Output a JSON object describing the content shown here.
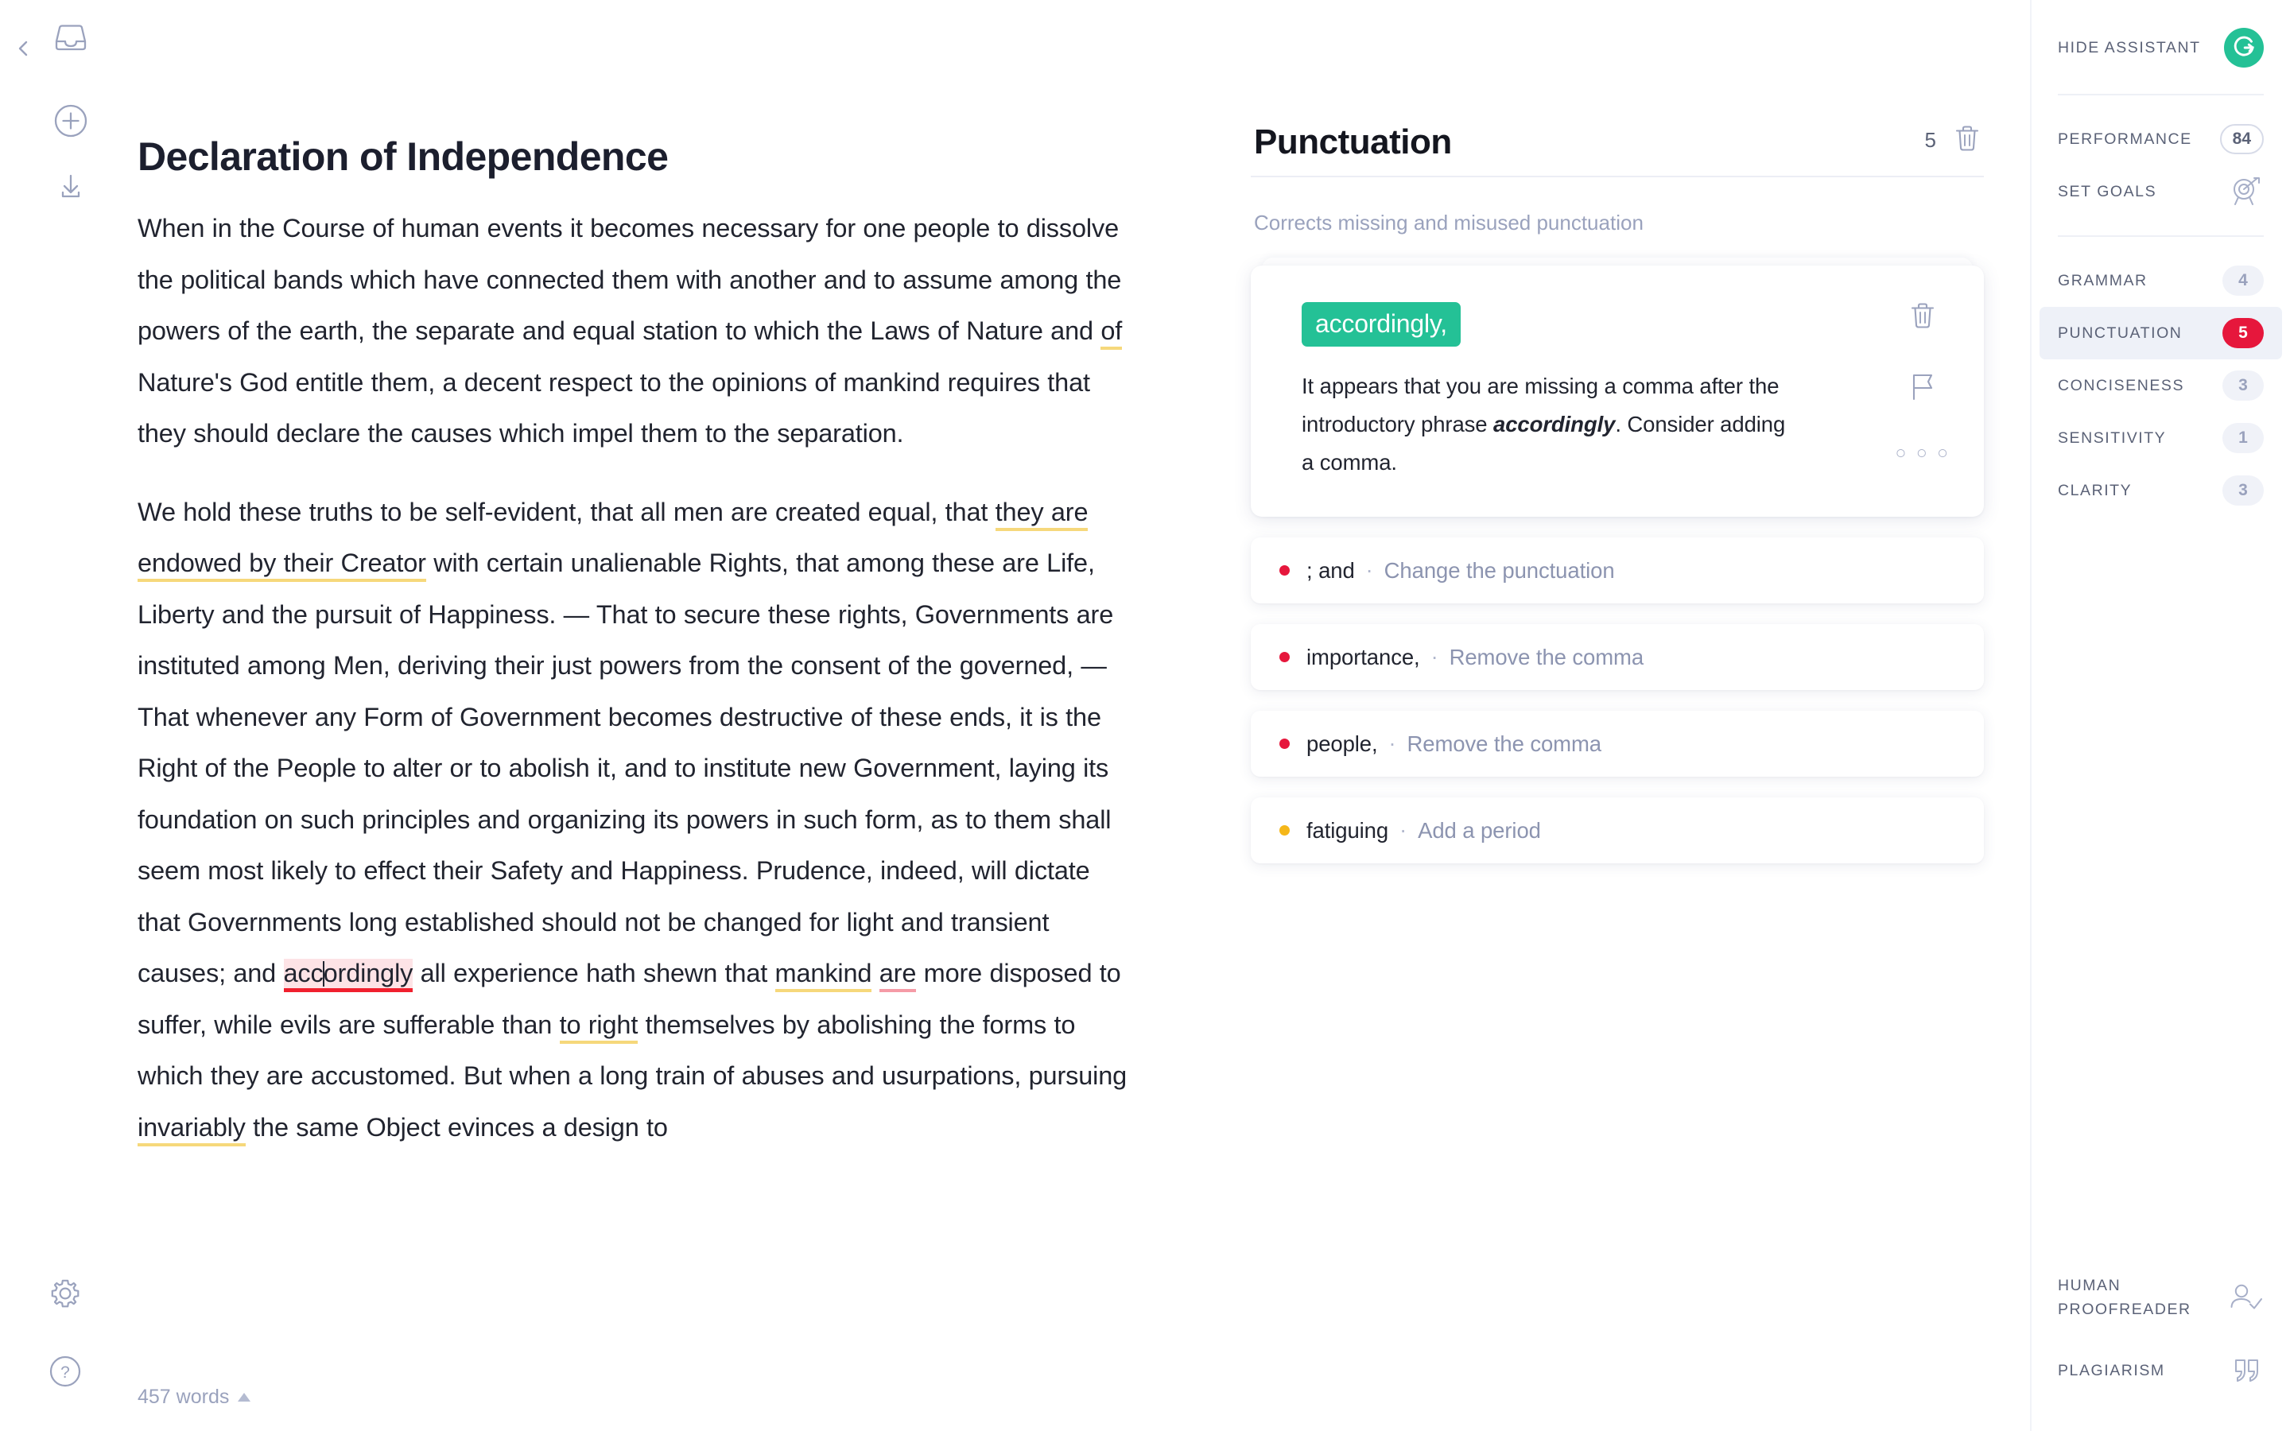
{
  "left_rail": {
    "back_icon": "chevron-left-icon",
    "inbox_icon": "inbox-icon",
    "new_icon": "plus-circle-icon",
    "download_icon": "download-icon",
    "settings_icon": "gear-icon",
    "help_icon": "question-circle-icon"
  },
  "document": {
    "title": "Declaration of Independence",
    "word_count": "457 words",
    "paragraphs": [
      {
        "runs": [
          {
            "text": "When in the Course of human events it becomes necessary for one people to dissolve the political bands which have connected them with another and to assume among the powers of the earth, the separate and equal station to which the Laws of Nature and ",
            "style": "plain"
          },
          {
            "text": "of",
            "style": "yellow"
          },
          {
            "text": " Nature's God entitle them, a decent respect to the opinions of mankind requires that they should declare the causes which impel them to the separation.",
            "style": "plain"
          }
        ]
      },
      {
        "runs": [
          {
            "text": "We hold these truths to be self-evident, that all men are created equal, that ",
            "style": "plain"
          },
          {
            "text": "they are endowed by their Creator",
            "style": "yellow"
          },
          {
            "text": " with certain unalienable Rights, that among these are Life, Liberty and the pursuit of Happiness. — That to secure these rights, Governments are instituted among Men, deriving their just powers from the consent of the governed, — That whenever any Form of Government becomes destructive of these ends, it is the Right of the People to alter or to abolish it, and to institute new Government, laying its foundation on such principles and organizing its powers in such form, as to them shall seem most likely to effect their Safety and Happiness. Prudence, indeed, will dictate that Governments long established should not be changed for light and transient causes; and ",
            "style": "plain"
          },
          {
            "text": "accordingly",
            "style": "active",
            "caret_after": 3
          },
          {
            "text": " all experience hath shewn that ",
            "style": "plain"
          },
          {
            "text": "mankind",
            "style": "yellow"
          },
          {
            "text": " ",
            "style": "plain"
          },
          {
            "text": "are",
            "style": "pink"
          },
          {
            "text": " more disposed to suffer, while evils are sufferable than ",
            "style": "plain"
          },
          {
            "text": "to right",
            "style": "yellow"
          },
          {
            "text": " themselves by abolishing the forms to which they are accustomed. But when a long train of abuses and usurpations, pursuing ",
            "style": "plain"
          },
          {
            "text": "invariably",
            "style": "yellow"
          },
          {
            "text": " the same Object evinces a design to",
            "style": "plain"
          }
        ]
      }
    ]
  },
  "assistant": {
    "title": "Punctuation",
    "count": "5",
    "delete_icon": "trash-icon",
    "subtitle": "Corrects missing and misused punctuation",
    "card": {
      "chip": "accordingly,",
      "explanation_before": "It appears that you are missing a comma after the introductory phrase ",
      "explanation_emphasis": "accordingly",
      "explanation_after": ". Consider adding a comma.",
      "delete_icon": "trash-icon",
      "flag_icon": "flag-icon",
      "more_icon": "more-options-icon",
      "more_glyph": "○ ○ ○"
    },
    "suggestions": [
      {
        "word": "; and",
        "separator": "·",
        "action": "Change the punctuation",
        "dot_color": "#e6173c"
      },
      {
        "word": "importance,",
        "separator": "·",
        "action": "Remove the comma",
        "dot_color": "#e6173c"
      },
      {
        "word": "people,",
        "separator": "·",
        "action": "Remove the comma",
        "dot_color": "#e6173c"
      },
      {
        "word": "fatiguing",
        "separator": "·",
        "action": "Add a period",
        "dot_color": "#f5b719"
      }
    ]
  },
  "sidebar": {
    "hide_label": "HIDE ASSISTANT",
    "logo_name": "grammarly-logo",
    "group1": [
      {
        "label": "PERFORMANCE",
        "value": "84",
        "pill": "outline",
        "name": "performance"
      },
      {
        "label": "SET GOALS",
        "value": "",
        "pill": "icon",
        "icon": "target-icon",
        "name": "set-goals"
      }
    ],
    "group2": [
      {
        "label": "GRAMMAR",
        "value": "4",
        "pill": "muted",
        "active": false,
        "name": "grammar"
      },
      {
        "label": "PUNCTUATION",
        "value": "5",
        "pill": "red",
        "active": true,
        "name": "punctuation"
      },
      {
        "label": "CONCISENESS",
        "value": "3",
        "pill": "muted",
        "active": false,
        "name": "conciseness"
      },
      {
        "label": "SENSITIVITY",
        "value": "1",
        "pill": "muted",
        "active": false,
        "name": "sensitivity"
      },
      {
        "label": "CLARITY",
        "value": "3",
        "pill": "muted",
        "active": false,
        "name": "clarity"
      }
    ],
    "bottom": [
      {
        "label": "HUMAN PROOFREADER",
        "icon": "person-check-icon",
        "name": "human-proofreader"
      },
      {
        "label": "PLAGIARISM",
        "icon": "quotation-marks-icon",
        "name": "plagiarism"
      }
    ]
  },
  "colors": {
    "brand_green": "#24c196",
    "alert_red": "#e6173c",
    "warning_yellow": "#f5b719",
    "underline_yellow": "#f6d87b",
    "underline_pink": "#f59ba6",
    "active_highlight_bg": "#fde3e6"
  }
}
